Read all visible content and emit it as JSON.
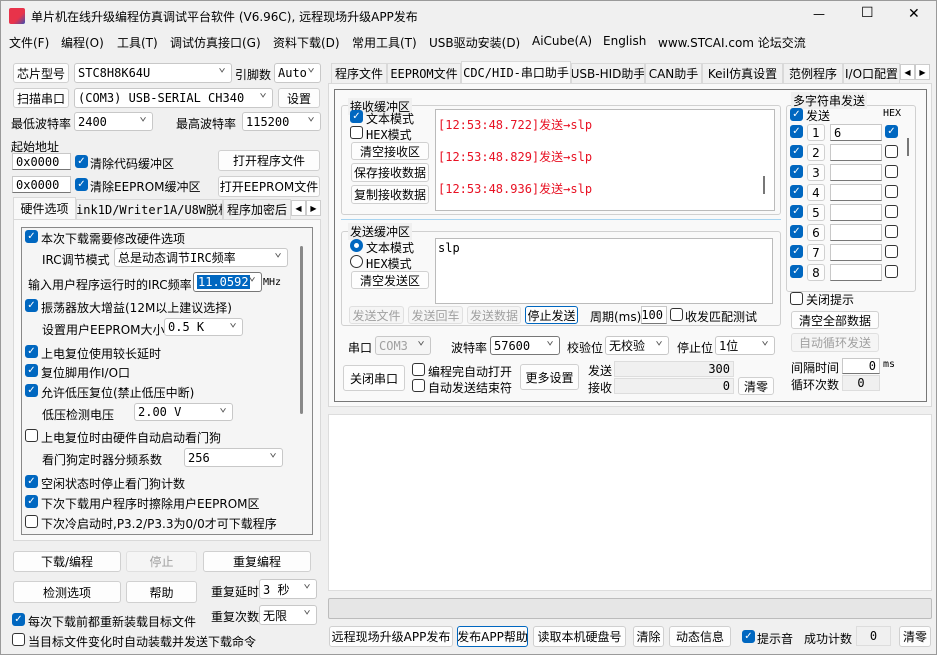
{
  "window": {
    "title": "单片机在线升级编程仿真调试平台软件 (V6.96C), 远程现场升级APP发布",
    "minimize": "—",
    "maximize": "☐",
    "close": "✕"
  },
  "menu": [
    "文件(F)",
    "编程(O)",
    "工具(T)",
    "调试仿真接口(G)",
    "资料下载(D)",
    "常用工具(T)",
    "USB驱动安装(D)",
    "AiCube(A)",
    "English",
    "www.STCAI.com 论坛交流"
  ],
  "left": {
    "chip_label": "芯片型号",
    "chip_value": "STC8H8K64U",
    "pins_label": "引脚数",
    "pins_value": "Auto",
    "scan_label": "扫描串口",
    "port_value": "(COM3) USB-SERIAL CH340",
    "settings_label": "设置",
    "min_baud_label": "最低波特率",
    "min_baud": "2400",
    "max_baud_label": "最高波特率",
    "max_baud": "115200",
    "start_addr_label": "起始地址",
    "addr1": "0x0000",
    "clear_code": "清除代码缓冲区",
    "open_prog": "打开程序文件",
    "addr2": "0x0000",
    "clear_eeprom": "清除EEPROM缓冲区",
    "open_eeprom": "打开EEPROM文件",
    "tabs": [
      "硬件选项",
      "Link1D/Writer1A/U8W脱机",
      "程序加密后"
    ],
    "hw": {
      "opt1": "本次下载需要修改硬件选项",
      "irc_mode_label": "IRC调节模式",
      "irc_mode": "总是动态调节IRC频率",
      "irc_freq_label": "输入用户程序运行时的IRC频率",
      "irc_freq": "11.0592",
      "mhz": "MHz",
      "opt2": "振荡器放大增益(12M以上建议选择)",
      "eeprom_size_label": "设置用户EEPROM大小",
      "eeprom_size": "0.5 K",
      "opt3": "上电复位使用较长延时",
      "opt4": "复位脚用作I/O口",
      "opt5": "允许低压复位(禁止低压中断)",
      "lvd_label": "低压检测电压",
      "lvd": "2.00 V",
      "opt6": "上电复位时由硬件自动启动看门狗",
      "wdt_label": "看门狗定时器分频系数",
      "wdt": "256",
      "opt7": "空闲状态时停止看门狗计数",
      "opt8": "下次下载用户程序时擦除用户EEPROM区",
      "opt9": "下次冷启动时,P3.2/P3.3为0/0才可下载程序"
    },
    "download": "下载/编程",
    "stop": "停止",
    "repeat_prog": "重复编程",
    "check_opts": "检测选项",
    "help": "帮助",
    "repeat_delay_label": "重复延时",
    "repeat_delay": "3 秒",
    "repeat_count_label": "重复次数",
    "repeat_count": "无限",
    "reload_each": "每次下载前都重新装载目标文件",
    "auto_reload": "当目标文件变化时自动装载并发送下载命令"
  },
  "right": {
    "tabs": [
      "程序文件",
      "EEPROM文件",
      "CDC/HID-串口助手",
      "USB-HID助手",
      "CAN助手",
      "Keil仿真设置",
      "范例程序",
      "I/O口配置"
    ],
    "recv": {
      "title": "接收缓冲区",
      "text_mode": "文本模式",
      "hex_mode": "HEX模式",
      "clear": "清空接收区",
      "save": "保存接收数据",
      "copy": "复制接收数据",
      "lines": [
        "[12:53:48.722]发送→slp",
        "[12:53:48.829]发送→slp",
        "[12:53:48.936]发送→slp"
      ]
    },
    "send": {
      "title": "发送缓冲区",
      "text_mode": "文本模式",
      "hex_mode": "HEX模式",
      "clear": "清空发送区",
      "content": "slp",
      "send_file": "发送文件",
      "send_cr": "发送回车",
      "send_data": "发送数据",
      "stop_send": "停止发送",
      "period_label": "周期(ms)",
      "period": "100",
      "match_test": "收发匹配测试"
    },
    "port_label": "串口",
    "port": "COM3",
    "baud_label": "波特率",
    "baud": "57600",
    "parity_label": "校验位",
    "parity": "无校验",
    "stop_label": "停止位",
    "stopbits": "1位",
    "close_port": "关闭串口",
    "auto_open": "编程完自动打开",
    "auto_end": "自动发送结束符",
    "more": "更多设置",
    "sent_label": "发送",
    "sent": "300",
    "recv_label": "接收",
    "recvd": "0",
    "clear_counts": "清零",
    "multi": {
      "title": "多字符串发送",
      "send": "发送",
      "hex": "HEX",
      "rows": [
        {
          "n": "1",
          "v": "6",
          "hex": true
        },
        {
          "n": "2",
          "v": "",
          "hex": false
        },
        {
          "n": "3",
          "v": "",
          "hex": false
        },
        {
          "n": "4",
          "v": "",
          "hex": false
        },
        {
          "n": "5",
          "v": "",
          "hex": false
        },
        {
          "n": "6",
          "v": "",
          "hex": false
        },
        {
          "n": "7",
          "v": "",
          "hex": false
        },
        {
          "n": "8",
          "v": "",
          "hex": false
        }
      ],
      "close_tip": "关闭提示",
      "clear_all": "清空全部数据",
      "auto_loop": "自动循环发送",
      "interval_label": "间隔时间",
      "interval": "0",
      "ms": "ms",
      "loop_label": "循环次数",
      "loops": "0"
    },
    "bottom": {
      "publish": "远程现场升级APP发布",
      "publish_help": "发布APP帮助",
      "read_disk": "读取本机硬盘号",
      "clear": "清除",
      "dyn": "动态信息",
      "beep": "提示音",
      "success_label": "成功计数",
      "success": "0",
      "reset": "清零"
    }
  },
  "colors": {
    "accent": "#0067c0",
    "log_text": "#e81123"
  }
}
